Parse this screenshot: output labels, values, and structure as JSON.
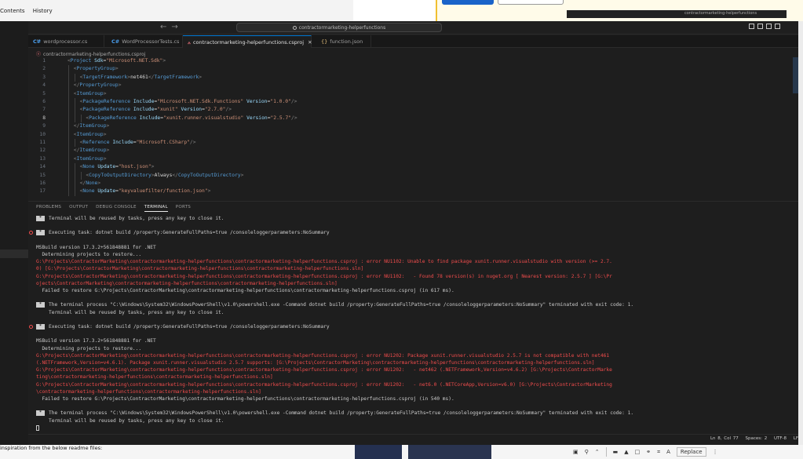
{
  "background": {
    "history_tabs": [
      "Contents",
      "History"
    ],
    "readme_text": "inspiration from the below readme files:",
    "mini_window_text": "contractormarketing-helperfunctions",
    "tools_replace": "Replace"
  },
  "titlebar": {
    "search": "contractormarketing-helperfunctions"
  },
  "tabs": [
    {
      "label": "wordprocessor.cs"
    },
    {
      "label": "WordProcessorTests.cs"
    },
    {
      "label": "contractormarketing-helperfunctions.csproj"
    },
    {
      "label": "function.json"
    }
  ],
  "breadcrumb": "contractormarketing-helperfunctions.csproj",
  "editor": {
    "lines": [
      {
        "n": "1",
        "indent": 0,
        "parts": [
          [
            "tg",
            "<"
          ],
          [
            "tn",
            "Project "
          ],
          [
            "at",
            "Sdk"
          ],
          [
            "tx",
            "="
          ],
          [
            "sv",
            "\"Microsoft.NET.Sdk\""
          ],
          [
            "tg",
            ">"
          ]
        ]
      },
      {
        "n": "2",
        "indent": 1,
        "parts": [
          [
            "tg",
            "<"
          ],
          [
            "tn",
            "PropertyGroup"
          ],
          [
            "tg",
            ">"
          ]
        ]
      },
      {
        "n": "3",
        "indent": 2,
        "parts": [
          [
            "tg",
            "<"
          ],
          [
            "tn",
            "TargetFramework"
          ],
          [
            "tg",
            ">"
          ],
          [
            "tx",
            "net461"
          ],
          [
            "tg",
            "</"
          ],
          [
            "tn",
            "TargetFramework"
          ],
          [
            "tg",
            ">"
          ]
        ]
      },
      {
        "n": "4",
        "indent": 1,
        "parts": [
          [
            "tg",
            "</"
          ],
          [
            "tn",
            "PropertyGroup"
          ],
          [
            "tg",
            ">"
          ]
        ]
      },
      {
        "n": "5",
        "indent": 1,
        "parts": [
          [
            "tg",
            "<"
          ],
          [
            "tn",
            "ItemGroup"
          ],
          [
            "tg",
            ">"
          ]
        ]
      },
      {
        "n": "6",
        "indent": 2,
        "parts": [
          [
            "tg",
            "<"
          ],
          [
            "tn",
            "PackageReference "
          ],
          [
            "at",
            "Include"
          ],
          [
            "tx",
            "="
          ],
          [
            "sv",
            "\"Microsoft.NET.Sdk.Functions\""
          ],
          [
            "tx",
            " "
          ],
          [
            "at",
            "Version"
          ],
          [
            "tx",
            "="
          ],
          [
            "sv",
            "\"1.0.0\""
          ],
          [
            "tg",
            "/>"
          ]
        ]
      },
      {
        "n": "7",
        "indent": 2,
        "parts": [
          [
            "tg",
            "<"
          ],
          [
            "tn",
            "PackageReference "
          ],
          [
            "at",
            "Include"
          ],
          [
            "tx",
            "="
          ],
          [
            "sv",
            "\"xunit\""
          ],
          [
            "tx",
            " "
          ],
          [
            "at",
            "Version"
          ],
          [
            "tx",
            "="
          ],
          [
            "sv",
            "\"2.7.0\""
          ],
          [
            "tg",
            "/>"
          ]
        ]
      },
      {
        "n": "8",
        "indent": 3,
        "parts": [
          [
            "tg",
            "<"
          ],
          [
            "tn",
            "PackageReference "
          ],
          [
            "at",
            "Include"
          ],
          [
            "tx",
            "="
          ],
          [
            "sv",
            "\"xunit.runner.visualstudio\""
          ],
          [
            "tx",
            " "
          ],
          [
            "at",
            "Version"
          ],
          [
            "tx",
            "="
          ],
          [
            "sv",
            "\"2.5.7\""
          ],
          [
            "tg",
            "/>"
          ]
        ]
      },
      {
        "n": "9",
        "indent": 1,
        "parts": [
          [
            "tg",
            "</"
          ],
          [
            "tn",
            "ItemGroup"
          ],
          [
            "tg",
            ">"
          ]
        ]
      },
      {
        "n": "10",
        "indent": 1,
        "parts": [
          [
            "tg",
            "<"
          ],
          [
            "tn",
            "ItemGroup"
          ],
          [
            "tg",
            ">"
          ]
        ]
      },
      {
        "n": "11",
        "indent": 2,
        "parts": [
          [
            "tg",
            "<"
          ],
          [
            "tn",
            "Reference "
          ],
          [
            "at",
            "Include"
          ],
          [
            "tx",
            "="
          ],
          [
            "sv",
            "\"Microsoft.CSharp\""
          ],
          [
            "tg",
            "/>"
          ]
        ]
      },
      {
        "n": "12",
        "indent": 1,
        "parts": [
          [
            "tg",
            "</"
          ],
          [
            "tn",
            "ItemGroup"
          ],
          [
            "tg",
            ">"
          ]
        ]
      },
      {
        "n": "13",
        "indent": 1,
        "parts": [
          [
            "tg",
            "<"
          ],
          [
            "tn",
            "ItemGroup"
          ],
          [
            "tg",
            ">"
          ]
        ]
      },
      {
        "n": "14",
        "indent": 2,
        "parts": [
          [
            "tg",
            "<"
          ],
          [
            "tn",
            "None "
          ],
          [
            "at",
            "Update"
          ],
          [
            "tx",
            "="
          ],
          [
            "sv",
            "\"host.json\""
          ],
          [
            "tg",
            ">"
          ]
        ]
      },
      {
        "n": "15",
        "indent": 3,
        "parts": [
          [
            "tg",
            "<"
          ],
          [
            "tn",
            "CopyToOutputDirectory"
          ],
          [
            "tg",
            ">"
          ],
          [
            "tx",
            "Always"
          ],
          [
            "tg",
            "</"
          ],
          [
            "tn",
            "CopyToOutputDirectory"
          ],
          [
            "tg",
            ">"
          ]
        ]
      },
      {
        "n": "16",
        "indent": 2,
        "parts": [
          [
            "tg",
            "</"
          ],
          [
            "tn",
            "None"
          ],
          [
            "tg",
            ">"
          ]
        ]
      },
      {
        "n": "17",
        "indent": 2,
        "parts": [
          [
            "tg",
            "<"
          ],
          [
            "tn",
            "None "
          ],
          [
            "at",
            "Update"
          ],
          [
            "tx",
            "="
          ],
          [
            "sv",
            "\"keyvaluefilter/function.json\""
          ],
          [
            "tg",
            ">"
          ]
        ]
      }
    ]
  },
  "panel_tabs": [
    "PROBLEMS",
    "OUTPUT",
    "DEBUG CONSOLE",
    "TERMINAL",
    "PORTS"
  ],
  "terminal": {
    "lines": [
      {
        "kind": "mark",
        "text": "Terminal will be reused by tasks, press any key to close it."
      },
      {
        "kind": "gap"
      },
      {
        "kind": "markerr",
        "text": "Executing task: dotnet build /property:GenerateFullPaths=true /consoleloggerparameters:NoSummary"
      },
      {
        "kind": "gap"
      },
      {
        "kind": "plain",
        "text": "MSBuild version 17.3.2+561848881 for .NET"
      },
      {
        "kind": "plain",
        "text": "  Determining projects to restore..."
      },
      {
        "kind": "err",
        "text": "G:\\Projects\\ContractorMarketing\\contractormarketing-helperfunctions\\contractormarketing-helperfunctions.csproj : error NU1102: Unable to find package xunit.runner.visualstudio with version (>= 2.7."
      },
      {
        "kind": "err",
        "text": "0) [G:\\Projects\\ContractorMarketing\\contractormarketing-helperfunctions\\contractormarketing-helperfunctions.sln]"
      },
      {
        "kind": "err",
        "text": "G:\\Projects\\ContractorMarketing\\contractormarketing-helperfunctions\\contractormarketing-helperfunctions.csproj : error NU1102:   - Found 78 version(s) in nuget.org [ Nearest version: 2.5.7 ] [G:\\Pr"
      },
      {
        "kind": "err",
        "text": "ojects\\ContractorMarketing\\contractormarketing-helperfunctions\\contractormarketing-helperfunctions.sln]"
      },
      {
        "kind": "plain",
        "text": "  Failed to restore G:\\Projects\\ContractorMarketing\\contractormarketing-helperfunctions\\contractormarketing-helperfunctions.csproj (in 617 ms)."
      },
      {
        "kind": "gap"
      },
      {
        "kind": "mark",
        "text": "The terminal process \"C:\\Windows\\System32\\WindowsPowerShell\\v1.0\\powershell.exe -Command dotnet build /property:GenerateFullPaths=true /consoleloggerparameters:NoSummary\" terminated with exit code: 1."
      },
      {
        "kind": "cont",
        "text": "Terminal will be reused by tasks, press any key to close it."
      },
      {
        "kind": "gap"
      },
      {
        "kind": "markerr",
        "text": "Executing task: dotnet build /property:GenerateFullPaths=true /consoleloggerparameters:NoSummary"
      },
      {
        "kind": "gap"
      },
      {
        "kind": "plain",
        "text": "MSBuild version 17.3.2+561848881 for .NET"
      },
      {
        "kind": "plain",
        "text": "  Determining projects to restore..."
      },
      {
        "kind": "err",
        "text": "G:\\Projects\\ContractorMarketing\\contractormarketing-helperfunctions\\contractormarketing-helperfunctions.csproj : error NU1202: Package xunit.runner.visualstudio 2.5.7 is not compatible with net461"
      },
      {
        "kind": "err",
        "text": "(.NETFramework,Version=v4.6.1). Package xunit.runner.visualstudio 2.5.7 supports: [G:\\Projects\\ContractorMarketing\\contractormarketing-helperfunctions\\contractormarketing-helperfunctions.sln]"
      },
      {
        "kind": "err",
        "text": "G:\\Projects\\ContractorMarketing\\contractormarketing-helperfunctions\\contractormarketing-helperfunctions.csproj : error NU1202:   - net462 (.NETFramework,Version=v4.6.2) [G:\\Projects\\ContractorMarke"
      },
      {
        "kind": "err",
        "text": "ting\\contractormarketing-helperfunctions\\contractormarketing-helperfunctions.sln]"
      },
      {
        "kind": "err",
        "text": "G:\\Projects\\ContractorMarketing\\contractormarketing-helperfunctions\\contractormarketing-helperfunctions.csproj : error NU1202:   - net6.0 (.NETCoreApp,Version=v6.0) [G:\\Projects\\ContractorMarketing"
      },
      {
        "kind": "err",
        "text": "\\contractormarketing-helperfunctions\\contractormarketing-helperfunctions.sln]"
      },
      {
        "kind": "plain",
        "text": "  Failed to restore G:\\Projects\\ContractorMarketing\\contractormarketing-helperfunctions\\contractormarketing-helperfunctions.csproj (in 540 ms)."
      },
      {
        "kind": "gap"
      },
      {
        "kind": "mark",
        "text": "The terminal process \"C:\\Windows\\System32\\WindowsPowerShell\\v1.0\\powershell.exe -Command dotnet build /property:GenerateFullPaths=true /consoleloggerparameters:NoSummary\" terminated with exit code: 1."
      },
      {
        "kind": "cont",
        "text": "Terminal will be reused by tasks, press any key to close it."
      },
      {
        "kind": "cursor"
      }
    ]
  },
  "statusbar": {
    "position": "Ln 8, Col 77",
    "spaces": "Spaces: 2",
    "encoding": "UTF-8",
    "eol": "LF"
  },
  "colors": {
    "error_text": "#f14c4c",
    "active_tab_border": "#0078d4",
    "editor_bg": "#1e1e1e"
  }
}
